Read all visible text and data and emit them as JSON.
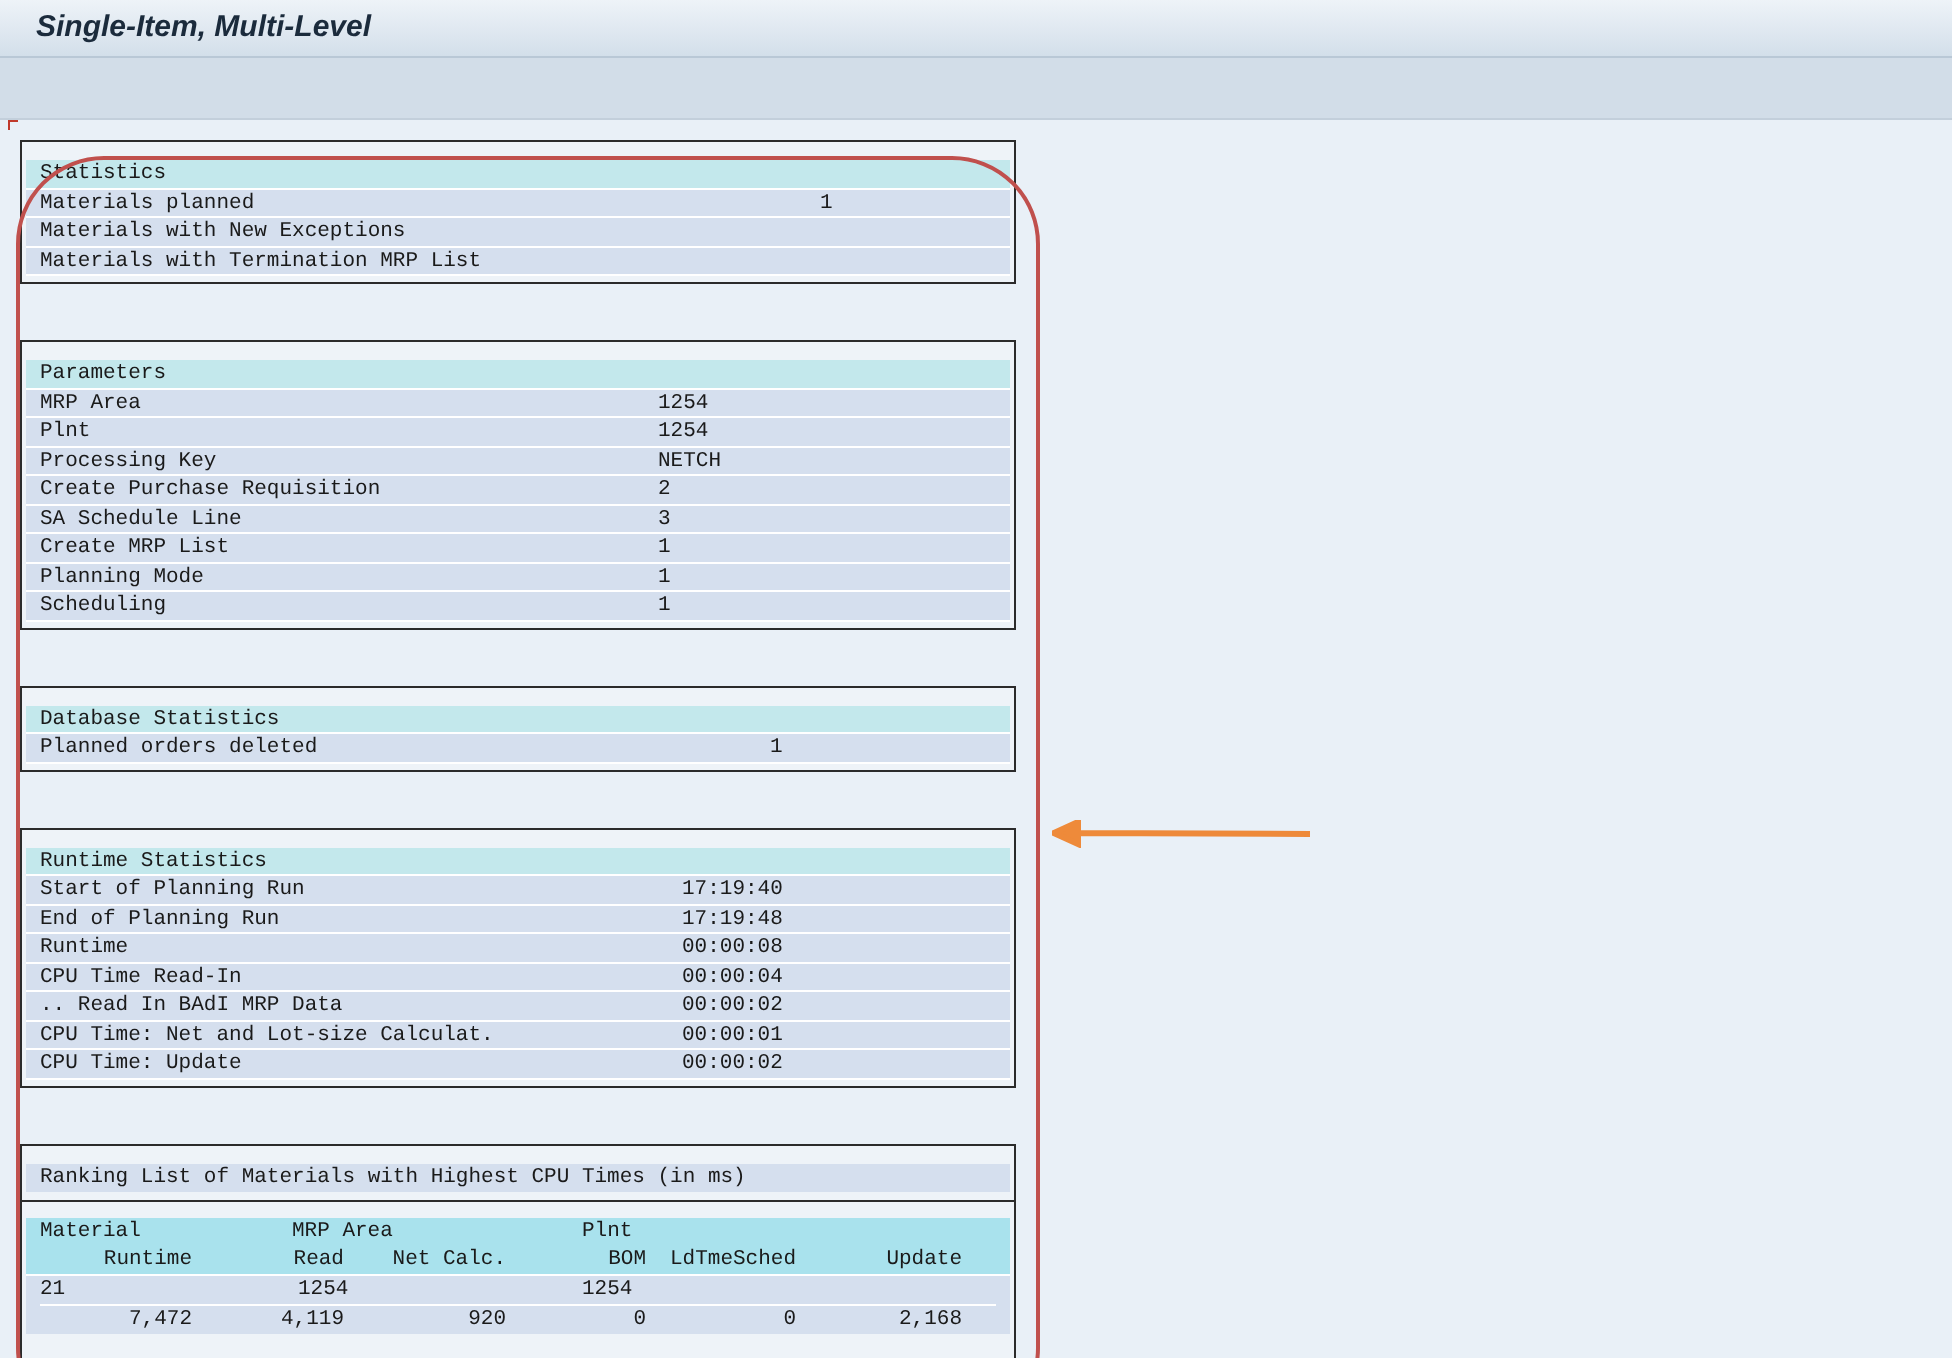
{
  "window": {
    "title": "Single-Item, Multi-Level"
  },
  "sections": [
    {
      "title": "Statistics",
      "rows": [
        {
          "label": "Materials planned",
          "value": "1"
        },
        {
          "label": "Materials with New Exceptions"
        },
        {
          "label": "Materials with Termination MRP List"
        }
      ]
    },
    {
      "title": "Parameters",
      "rows": [
        {
          "label": "MRP Area",
          "value": "1254"
        },
        {
          "label": "Plnt",
          "value": "1254"
        },
        {
          "label": "Processing Key",
          "value": "NETCH"
        },
        {
          "label": "Create Purchase Requisition",
          "value": "2"
        },
        {
          "label": "SA Schedule Line",
          "value": "3"
        },
        {
          "label": "Create MRP List",
          "value": "1"
        },
        {
          "label": "Planning Mode",
          "value": "1"
        },
        {
          "label": "Scheduling",
          "value": "1"
        }
      ]
    },
    {
      "title": "Database Statistics",
      "rows": [
        {
          "label": "Planned orders deleted",
          "value": "1"
        }
      ]
    },
    {
      "title": "Runtime Statistics",
      "rows": [
        {
          "label": "Start of Planning Run",
          "value": "17:19:40"
        },
        {
          "label": "End of Planning Run",
          "value": "17:19:48"
        },
        {
          "label": "Runtime",
          "value": "00:00:08"
        },
        {
          "label": "CPU Time Read-In",
          "value": "00:00:04"
        },
        {
          "label": ".. Read In BAdI MRP Data",
          "value": "00:00:02"
        },
        {
          "label": "CPU Time: Net and Lot-size Calculat.",
          "value": "00:00:01"
        },
        {
          "label": "CPU Time: Update",
          "value": "00:00:02"
        }
      ]
    }
  ],
  "ranking": {
    "title": "Ranking List of Materials with Highest CPU Times (in ms)",
    "header_line_1": [
      "Material",
      "MRP Area",
      "Plnt"
    ],
    "header_line_2": [
      "Runtime",
      "Read",
      "Net Calc.",
      "BOM",
      "LdTmeSched",
      "Update"
    ],
    "rows": [
      {
        "line_1": [
          "21",
          "1254",
          "1254"
        ],
        "line_2": [
          "7,472",
          "4,119",
          "920",
          "0",
          "0",
          "2,168"
        ]
      }
    ]
  }
}
